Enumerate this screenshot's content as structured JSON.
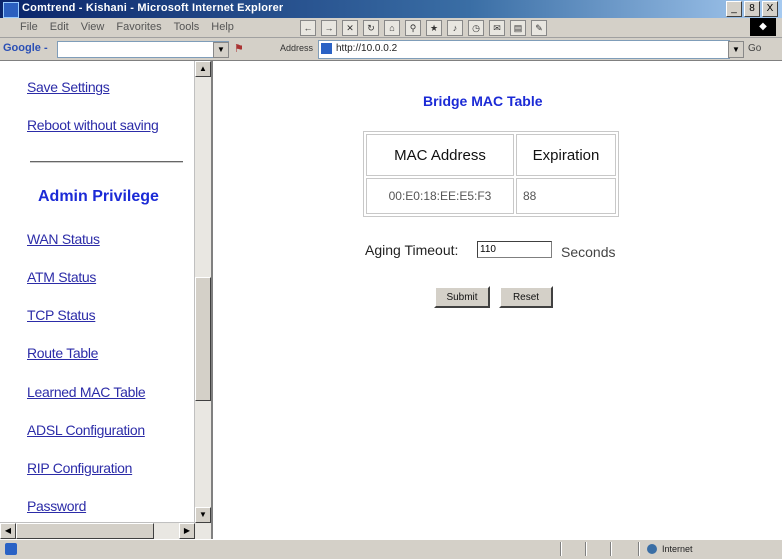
{
  "window": {
    "title": "Comtrend - Kishani - Microsoft Internet Explorer",
    "controls": [
      "_",
      "8",
      "X"
    ]
  },
  "menu": [
    "File",
    "Edit",
    "View",
    "Favorites",
    "Tools",
    "Help"
  ],
  "toolbar": {
    "google_label": "Google -",
    "address_label": "Address",
    "url": "http://10.0.0.2",
    "go_label": "Go"
  },
  "sidebar": {
    "items_top": [
      {
        "label": "Save Settings"
      },
      {
        "label": "Reboot without saving"
      }
    ],
    "admin_heading": "Admin Privilege",
    "items": [
      {
        "label": "WAN Status"
      },
      {
        "label": "ATM Status"
      },
      {
        "label": "TCP Status"
      },
      {
        "label": "Route Table"
      },
      {
        "label": "Learned MAC Table"
      },
      {
        "label": "ADSL Configuration"
      },
      {
        "label": "RIP Configuration"
      },
      {
        "label": "Password"
      }
    ]
  },
  "main": {
    "title": "Bridge MAC Table",
    "table": {
      "headers": [
        "MAC Address",
        "Expiration"
      ],
      "rows": [
        [
          "00:E0:18:EE:E5:F3",
          "88"
        ]
      ]
    },
    "aging_label": "Aging Timeout:",
    "aging_value": "110",
    "seconds_label": "Seconds",
    "submit_label": "Submit",
    "reset_label": "Reset"
  },
  "statusbar": {
    "zone": "Internet"
  }
}
